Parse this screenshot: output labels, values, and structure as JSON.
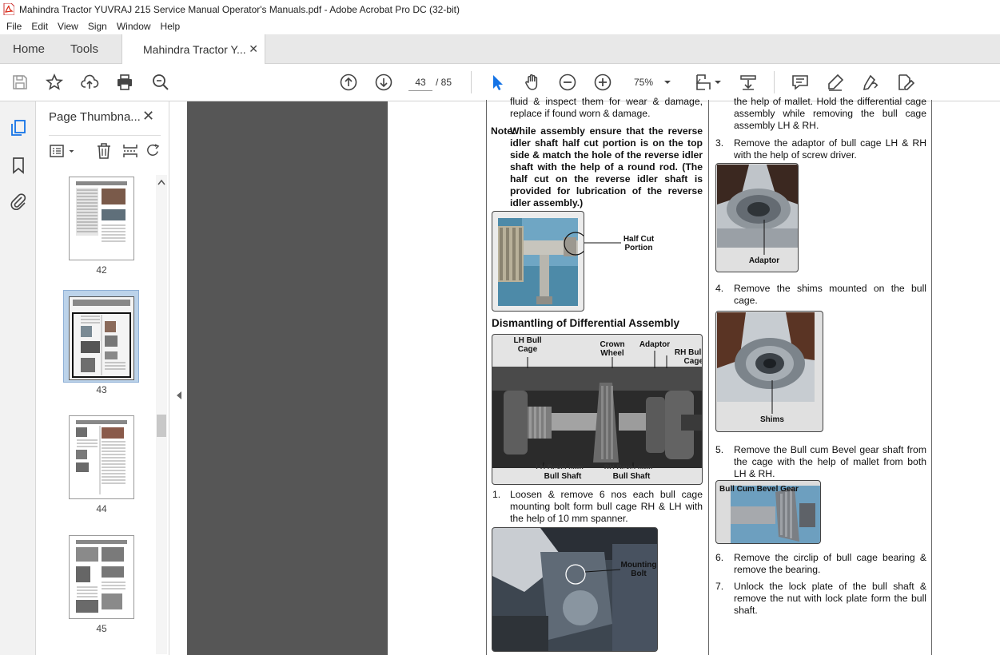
{
  "window": {
    "title": "Mahindra Tractor YUVRAJ 215 Service Manual Operator's Manuals.pdf - Adobe Acrobat Pro DC (32-bit)"
  },
  "menu": [
    "File",
    "Edit",
    "View",
    "Sign",
    "Window",
    "Help"
  ],
  "tabs": {
    "home": "Home",
    "tools": "Tools",
    "document": "Mahindra Tractor Y..."
  },
  "toolbar": {
    "current_page": "43",
    "page_total": "/ 85",
    "zoom": "75%"
  },
  "thumbnails": {
    "panel_title": "Page Thumbna...",
    "pages": [
      "42",
      "43",
      "44",
      "45"
    ],
    "selected": "43"
  },
  "document": {
    "left_col": {
      "top_text": "fluid & inspect them for wear & damage, replace if found worn & damage.",
      "note_label": "Note:",
      "note_text": "While assembly ensure that the reverse idler shaft half cut portion is on the top side & match the hole of the reverse idler shaft with the help of a round rod. (The half cut on the reverse idler shaft is provided for lubrication of the reverse idler assembly.)",
      "fig1_caption": "Half Cut Portion",
      "section_heading": "Dismantling of Differential Assembly",
      "fig2_labels": {
        "lh_bull_cage": "LH Bull Cage",
        "crown_wheel": "Crown Wheel",
        "adaptor": "Adaptor",
        "rh_bull_cage": "RH Bull Cage",
        "lh_bevel": "LH Bevel cum",
        "lh_bull_shaft": "Bull Shaft",
        "rh_bevel": "RH Bevel cum",
        "rh_bull_shaft": "Bull Shaft"
      },
      "step1_num": "1.",
      "step1": "Loosen & remove 6 nos each bull cage mounting bolt form bull cage RH & LH with the help of 10 mm spanner.",
      "fig3_caption": "Mounting Bolt"
    },
    "right_col": {
      "top_text": "the help of mallet. Hold the differential cage assembly while removing the bull cage assembly LH & RH.",
      "step3_num": "3.",
      "step3": "Remove the adaptor of bull cage LH & RH with the help of screw driver.",
      "fig4_caption": "Adaptor",
      "step4_num": "4.",
      "step4": "Remove the shims mounted on the bull cage.",
      "fig5_caption": "Shims",
      "step5_num": "5.",
      "step5": "Remove the Bull cum Bevel gear shaft from the cage with the help of mallet from both LH & RH.",
      "fig6_caption": "Bull Cum Bevel Gear",
      "step6_num": "6.",
      "step6": "Remove the circlip of bull cage bearing & remove the bearing.",
      "step7_num": "7.",
      "step7": "Unlock the lock plate of the bull shaft & remove the nut with lock plate form the bull shaft."
    }
  },
  "colors": {
    "accent_red": "#d9230f",
    "select_blue": "#bcd3ea",
    "doc_bg": "#565656",
    "cursor_blue": "#1473e6"
  }
}
